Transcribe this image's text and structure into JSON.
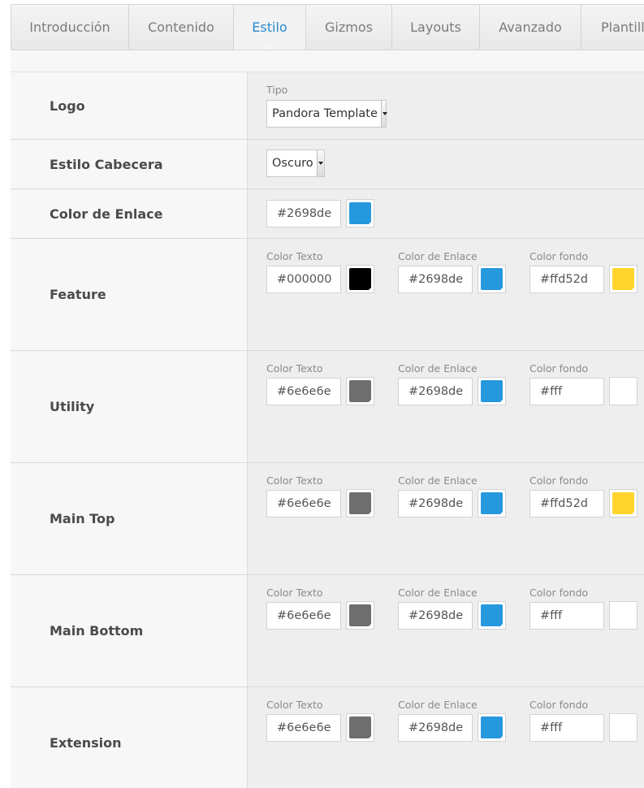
{
  "tabs": [
    {
      "label": "Introducción",
      "active": false
    },
    {
      "label": "Contenido",
      "active": false
    },
    {
      "label": "Estilo",
      "active": true
    },
    {
      "label": "Gizmos",
      "active": false
    },
    {
      "label": "Layouts",
      "active": false
    },
    {
      "label": "Avanzado",
      "active": false
    },
    {
      "label": "Plantilla",
      "active": false
    }
  ],
  "logo": {
    "label": "Logo",
    "tipo_label": "Tipo",
    "tipo_value": "Pandora Template"
  },
  "estilo_cabecera": {
    "label": "Estilo Cabecera",
    "value": "Oscuro"
  },
  "color_enlace": {
    "label": "Color de Enlace",
    "value": "#2698de",
    "color": "#2698de"
  },
  "field_labels": {
    "text": "Color Texto",
    "link": "Color de Enlace",
    "bg": "Color fondo"
  },
  "sections": [
    {
      "label": "Feature",
      "text": {
        "value": "#000000",
        "color": "#000000"
      },
      "link": {
        "value": "#2698de",
        "color": "#2698de"
      },
      "bg": {
        "value": "#ffd52d",
        "color": "#ffd52d"
      }
    },
    {
      "label": "Utility",
      "text": {
        "value": "#6e6e6e",
        "color": "#6e6e6e"
      },
      "link": {
        "value": "#2698de",
        "color": "#2698de"
      },
      "bg": {
        "value": "#fff",
        "color": "#ffffff"
      }
    },
    {
      "label": "Main Top",
      "text": {
        "value": "#6e6e6e",
        "color": "#6e6e6e"
      },
      "link": {
        "value": "#2698de",
        "color": "#2698de"
      },
      "bg": {
        "value": "#ffd52d",
        "color": "#ffd52d"
      }
    },
    {
      "label": "Main Bottom",
      "text": {
        "value": "#6e6e6e",
        "color": "#6e6e6e"
      },
      "link": {
        "value": "#2698de",
        "color": "#2698de"
      },
      "bg": {
        "value": "#fff",
        "color": "#ffffff"
      }
    },
    {
      "label": "Extension",
      "text": {
        "value": "#6e6e6e",
        "color": "#6e6e6e"
      },
      "link": {
        "value": "#2698de",
        "color": "#2698de"
      },
      "bg": {
        "value": "#fff",
        "color": "#ffffff"
      }
    }
  ]
}
